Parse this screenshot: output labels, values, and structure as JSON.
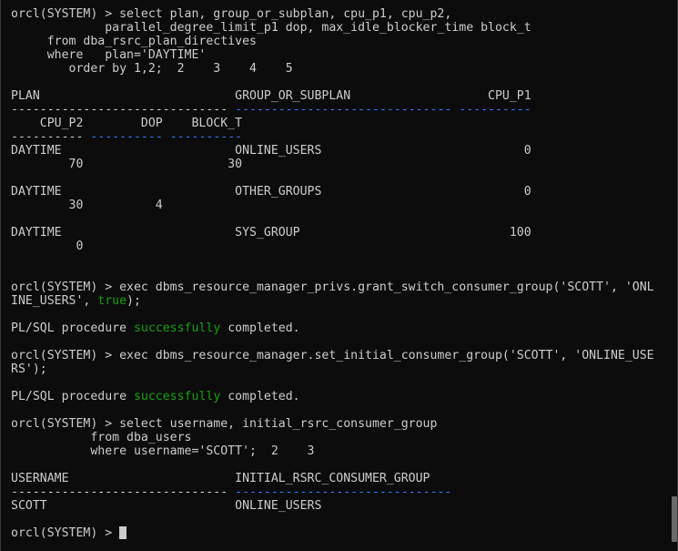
{
  "terminal": {
    "lines": [
      {
        "segs": [
          {
            "t": "orcl(SYSTEM) > select plan, group_or_subplan, cpu_p1, cpu_p2,"
          }
        ]
      },
      {
        "segs": [
          {
            "t": "             parallel_degree_limit_p1 dop, max_idle_blocker_time block_t"
          }
        ]
      },
      {
        "segs": [
          {
            "t": "     from dba_rsrc_plan_directives"
          }
        ]
      },
      {
        "segs": [
          {
            "t": "     where   plan='DAYTIME'"
          }
        ]
      },
      {
        "segs": [
          {
            "t": "        order by 1,2;  2    3    4    5"
          }
        ]
      },
      {
        "segs": []
      },
      {
        "segs": [
          {
            "t": "PLAN                           GROUP_OR_SUBPLAN                   CPU_P1"
          }
        ]
      },
      {
        "segs": [
          {
            "t": "------------------------------ ",
            "c": "dash"
          },
          {
            "t": "------------------------------",
            "c": "bdash"
          },
          {
            "t": " "
          },
          {
            "t": "----------",
            "c": "bdash"
          }
        ]
      },
      {
        "segs": [
          {
            "t": "    CPU_P2        DOP    BLOCK_T"
          }
        ]
      },
      {
        "segs": [
          {
            "t": "----------",
            "c": "dash"
          },
          {
            "t": " "
          },
          {
            "t": "----------",
            "c": "bdash"
          },
          {
            "t": " "
          },
          {
            "t": "----------",
            "c": "bdash"
          }
        ]
      },
      {
        "segs": [
          {
            "t": "DAYTIME                        ONLINE_USERS                            0"
          }
        ]
      },
      {
        "segs": [
          {
            "t": "        70                    30"
          }
        ]
      },
      {
        "segs": []
      },
      {
        "segs": [
          {
            "t": "DAYTIME                        OTHER_GROUPS                            0"
          }
        ]
      },
      {
        "segs": [
          {
            "t": "        30          4"
          }
        ]
      },
      {
        "segs": []
      },
      {
        "segs": [
          {
            "t": "DAYTIME                        SYS_GROUP                             100"
          }
        ]
      },
      {
        "segs": [
          {
            "t": "         0"
          }
        ]
      },
      {
        "segs": []
      },
      {
        "segs": []
      },
      {
        "segs": [
          {
            "t": "orcl(SYSTEM) > exec dbms_resource_manager_privs.grant_switch_consumer_group('SCOTT', 'ONL"
          }
        ]
      },
      {
        "segs": [
          {
            "t": "INE_USERS', "
          },
          {
            "t": "true",
            "c": "kw"
          },
          {
            "t": ");"
          }
        ]
      },
      {
        "segs": []
      },
      {
        "segs": [
          {
            "t": "PL/SQL procedure "
          },
          {
            "t": "successfully",
            "c": "kw"
          },
          {
            "t": " completed."
          }
        ]
      },
      {
        "segs": []
      },
      {
        "segs": [
          {
            "t": "orcl(SYSTEM) > exec dbms_resource_manager.set_initial_consumer_group('SCOTT', 'ONLINE_USE"
          }
        ]
      },
      {
        "segs": [
          {
            "t": "RS');"
          }
        ]
      },
      {
        "segs": []
      },
      {
        "segs": [
          {
            "t": "PL/SQL procedure "
          },
          {
            "t": "successfully",
            "c": "kw"
          },
          {
            "t": " completed."
          }
        ]
      },
      {
        "segs": []
      },
      {
        "segs": [
          {
            "t": "orcl(SYSTEM) > select username, initial_rsrc_consumer_group"
          }
        ]
      },
      {
        "segs": [
          {
            "t": "           from dba_users"
          }
        ]
      },
      {
        "segs": [
          {
            "t": "           where username='SCOTT';  2    3"
          }
        ]
      },
      {
        "segs": []
      },
      {
        "segs": [
          {
            "t": "USERNAME                       INITIAL_RSRC_CONSUMER_GROUP"
          }
        ]
      },
      {
        "segs": [
          {
            "t": "------------------------------ ",
            "c": "dash"
          },
          {
            "t": "------------------------------",
            "c": "bdash"
          }
        ]
      },
      {
        "segs": [
          {
            "t": "SCOTT                          ONLINE_USERS"
          }
        ]
      },
      {
        "segs": []
      },
      {
        "segs": [
          {
            "t": "orcl(SYSTEM) > "
          }
        ],
        "cursor": true
      }
    ]
  },
  "colors": {
    "background": "#0c0c0c",
    "foreground": "#cccccc",
    "keyword_green": "#13a10e",
    "dash_blue": "#3b78ff"
  }
}
